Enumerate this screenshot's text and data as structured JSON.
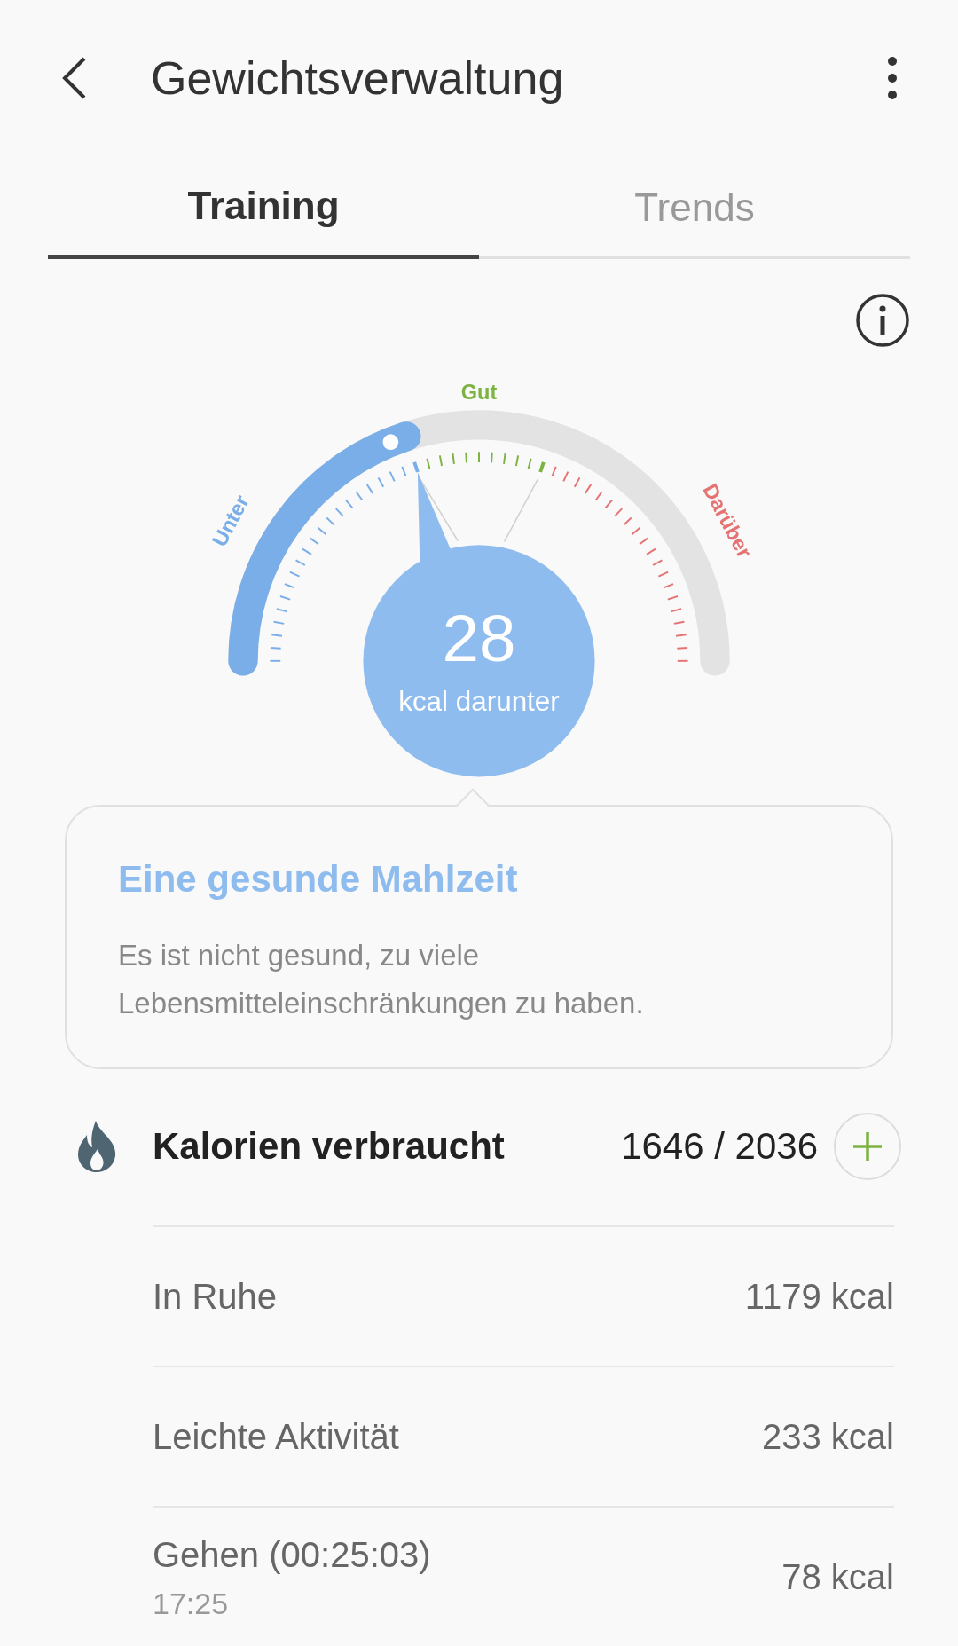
{
  "header": {
    "title": "Gewichtsverwaltung"
  },
  "tabs": [
    {
      "label": "Training",
      "selected": true
    },
    {
      "label": "Trends",
      "selected": false
    }
  ],
  "gauge": {
    "value": "28",
    "unit": "kcal darunter",
    "zones": [
      {
        "label": "Unter",
        "color": "#7aaee8"
      },
      {
        "label": "Gut",
        "color": "#7cb342"
      },
      {
        "label": "Darüber",
        "color": "#e57373"
      }
    ]
  },
  "tip": {
    "title": "Eine gesunde Mahlzeit",
    "text": "Es ist nicht gesund, zu viele Lebensmitteleinschränkungen zu haben."
  },
  "calories": {
    "label": "Kalorien verbraucht",
    "value": "1646 / 2036",
    "items": [
      {
        "label": "In Ruhe",
        "value": "1179 kcal"
      },
      {
        "label": "Leichte Aktivität",
        "value": "233 kcal"
      },
      {
        "label": "Gehen (00:25:03)",
        "time": "17:25",
        "value": "78 kcal"
      }
    ]
  }
}
